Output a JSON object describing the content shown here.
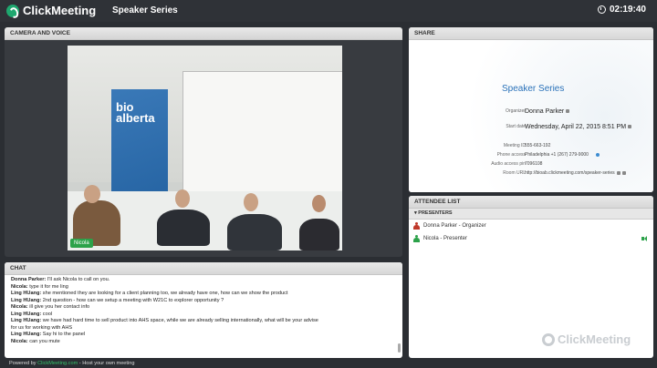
{
  "app": {
    "brand": "ClickMeeting",
    "meeting_title": "Speaker Series",
    "timer": "02:19:40"
  },
  "camera": {
    "header": "CAMERA AND VOICE",
    "banner_text": "bio alberta",
    "name_tag": "Nicola"
  },
  "share": {
    "header": "SHARE",
    "title": "Speaker Series",
    "organizer_label": "Organizer",
    "organizer": "Donna Parker",
    "start_label": "Start date",
    "start_date": "Wednesday, April 22, 2015 8:51 PM",
    "meeting_id_label": "Meeting ID",
    "meeting_id": "555-663-192",
    "phone_label": "Phone access",
    "phone": "Philadelphia +1 (267) 279-9000",
    "audio_pin_label": "Audio access pin",
    "audio_pin": "7096108",
    "room_url_label": "Room URL",
    "room_url": "http://bioab.clickmeeting.com/speaker-series"
  },
  "attendees": {
    "header": "ATTENDEE LIST",
    "section": "PRESENTERS",
    "list": [
      {
        "name": "Donna Parker - Organizer",
        "color": "#c0392b"
      },
      {
        "name": "Nicola - Presenter",
        "color": "#2ca24a"
      }
    ],
    "watermark": "ClickMeeting"
  },
  "chat": {
    "header": "CHAT",
    "messages": [
      {
        "user": "Donna Parker:",
        "text": " I'll ask Nicola to call on you."
      },
      {
        "user": "Nicola:",
        "text": " type it for me ling"
      },
      {
        "user": "Ling HUang:",
        "text": " she mentioned they are looking for a client planning too, we already have one, how can we show the product"
      },
      {
        "user": "Ling HUang:",
        "text": " 2nd question - how can we setup a meeting with W21C to explorer opportunity ?"
      },
      {
        "user": "Nicola:",
        "text": " ill give you her contact info"
      },
      {
        "user": "Ling HUang:",
        "text": " cool"
      },
      {
        "user": "Ling HUang:",
        "text": " we have had hard time to sell product into AHS space, while we are already selling internationally, what will be your advise"
      },
      {
        "user": "",
        "text": "for us for working with AHS"
      },
      {
        "user": "Ling HUang:",
        "text": " Say hi to the panel"
      },
      {
        "user": "Nicola:",
        "text": " can you mute"
      }
    ]
  },
  "footer": {
    "prefix": "Powered by ",
    "link": "ClickMeeting.com",
    "suffix": " - Host your own meeting"
  }
}
